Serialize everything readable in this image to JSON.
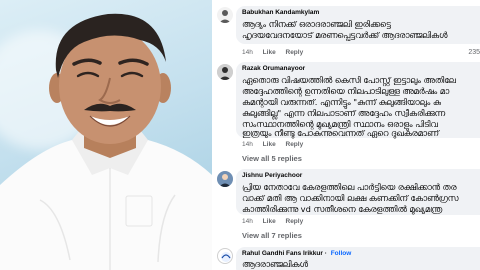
{
  "comments": [
    {
      "name": "Babukhan Kandamkylam",
      "lines": [
        "ആദ്യം നിനക്ക് ഒരാദരാഞ്ജലി ഇരിക്കട്ടെ",
        "ഹൃദയവേദനയോട് മരണപ്പെട്ടവർക്ക് ആദരാഞ്ജലികൾ"
      ],
      "time": "14h",
      "like": "Like",
      "reply": "Reply",
      "reactions": "235"
    },
    {
      "name": "Razak Orumanayoor",
      "lines": [
        "ഏതൊരു വിഷയത്തിൽ കെസി പോസ്റ്റ് ഇട്ടാലും അതിലേ",
        "അദ്ദേഹത്തിന്റെ ഉന്നതിയെ നിലപാടിലുള്ള അമർഷം മാ",
        "കമന്റായി വരുന്നത്. എന്നിട്ടും \"കുന്ന് കുലുങ്ങിയാലും കു",
        "കുലുങ്ങില്ല\" എന്ന നിലപാടാണ് അദ്ദേഹം സ്വീകരിക്കുന്ന",
        "സംസ്ഥാനത്തിന്റെ മുഖ്യമന്ത്രി സ്ഥാനം ഒരാളും പിടിവ",
        "ഇത്രയും നീണ്ടു പോകുന്നുവെന്നത് ഏറെ ദുഖകരമാണ്"
      ],
      "time": "14h",
      "like": "Like",
      "reply": "Reply",
      "view_replies": "View all 5 replies"
    },
    {
      "name": "Jishnu Periyachoor",
      "lines": [
        "പ്രിയ നേതാവേ കേരളത്തിലെ പാർട്ടിയെ രക്ഷിക്കാൻ തര",
        "വാക്ക് മതി ആ വാക്കിനായി ലക്ഷ കണക്കിന് കോൺഗ്രസ",
        "കാത്തിരിക്കുന്നു vd സതീശനെ കേരളത്തിൽ മുഖ്യമന്ത്ര"
      ],
      "time": "14h",
      "like": "Like",
      "reply": "Reply",
      "view_replies": "View all 7 replies"
    },
    {
      "name": "Rahul Gandhi Fans Irikkur",
      "follow": "Follow",
      "lines": [
        "ആദരാഞ്ജലികൾ"
      ]
    }
  ],
  "colors": {
    "bubble": "#f0f2f5",
    "follow": "#0866ff",
    "muted": "#65676b"
  }
}
